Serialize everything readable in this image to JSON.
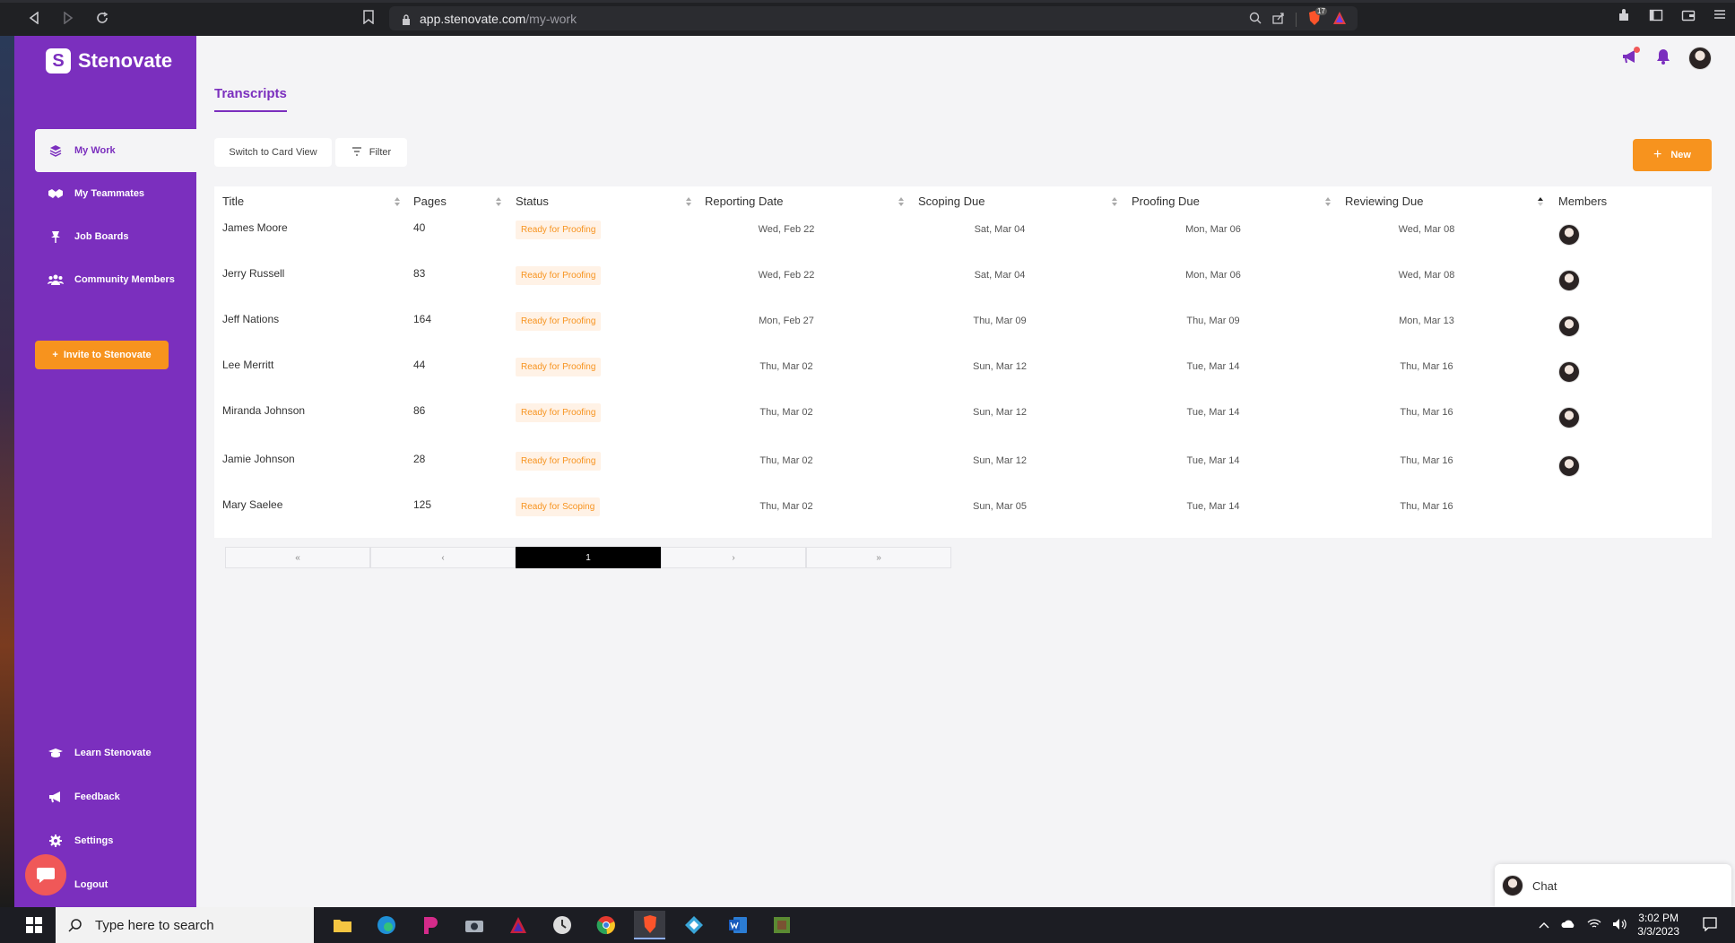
{
  "browser": {
    "url_host": "app.stenovate.com",
    "url_path": "/my-work",
    "brave_badge": "17"
  },
  "brand": {
    "name": "Stenovate",
    "logo_letter": "S"
  },
  "sidebar": {
    "items": [
      {
        "label": "My Work",
        "icon": "layers-icon"
      },
      {
        "label": "My Teammates",
        "icon": "handshake-icon"
      },
      {
        "label": "Job Boards",
        "icon": "pin-icon"
      },
      {
        "label": "Community Members",
        "icon": "users-icon"
      }
    ],
    "invite_label": "Invite to Stenovate",
    "bottom_items": [
      {
        "label": "Learn Stenovate",
        "icon": "graduation-cap-icon"
      },
      {
        "label": "Feedback",
        "icon": "megaphone-icon"
      },
      {
        "label": "Settings",
        "icon": "gear-icon"
      },
      {
        "label": "Logout",
        "icon": "logout-icon"
      }
    ]
  },
  "main": {
    "tab_label": "Transcripts",
    "switch_view_label": "Switch to Card View",
    "filter_label": "Filter",
    "new_label": "New"
  },
  "table": {
    "columns": [
      "Title",
      "Pages",
      "Status",
      "Reporting Date",
      "Scoping Due",
      "Proofing Due",
      "Reviewing Due",
      "Members"
    ],
    "rows": [
      {
        "title": "James Moore",
        "pages": "40",
        "status": "Ready for Proofing",
        "reporting": "Wed, Feb 22",
        "scoping": "Sat, Mar 04",
        "proofing": "Mon, Mar 06",
        "reviewing": "Wed, Mar 08",
        "member": true
      },
      {
        "title": "Jerry Russell",
        "pages": "83",
        "status": "Ready for Proofing",
        "reporting": "Wed, Feb 22",
        "scoping": "Sat, Mar 04",
        "proofing": "Mon, Mar 06",
        "reviewing": "Wed, Mar 08",
        "member": true
      },
      {
        "title": "Jeff Nations",
        "pages": "164",
        "status": "Ready for Proofing",
        "reporting": "Mon, Feb 27",
        "scoping": "Thu, Mar 09",
        "proofing": "Thu, Mar 09",
        "reviewing": "Mon, Mar 13",
        "member": true
      },
      {
        "title": "Lee Merritt",
        "pages": "44",
        "status": "Ready for Proofing",
        "reporting": "Thu, Mar 02",
        "scoping": "Sun, Mar 12",
        "proofing": "Tue, Mar 14",
        "reviewing": "Thu, Mar 16",
        "member": true
      },
      {
        "title": "Miranda Johnson",
        "pages": "86",
        "status": "Ready for Proofing",
        "reporting": "Thu, Mar 02",
        "scoping": "Sun, Mar 12",
        "proofing": "Tue, Mar 14",
        "reviewing": "Thu, Mar 16",
        "member": true
      },
      {
        "title": "Jamie Johnson",
        "pages": "28",
        "status": "Ready for Proofing",
        "reporting": "Thu, Mar 02",
        "scoping": "Sun, Mar 12",
        "proofing": "Tue, Mar 14",
        "reviewing": "Thu, Mar 16",
        "member": true
      },
      {
        "title": "Mary Saelee",
        "pages": "125",
        "status": "Ready for Scoping",
        "reporting": "Thu, Mar 02",
        "scoping": "Sun, Mar 05",
        "proofing": "Tue, Mar 14",
        "reviewing": "Thu, Mar 16",
        "member": false
      }
    ]
  },
  "pagination": {
    "first": "«",
    "prev": "‹",
    "current": "1",
    "next": "›",
    "last": "»"
  },
  "chat": {
    "label": "Chat"
  },
  "taskbar": {
    "search_placeholder": "Type here to search",
    "time": "3:02 PM",
    "date": "3/3/2023"
  },
  "colors": {
    "brand_purple": "#7b2fbe",
    "accent_orange": "#f7931e",
    "badge_bg": "#fff2e6"
  }
}
